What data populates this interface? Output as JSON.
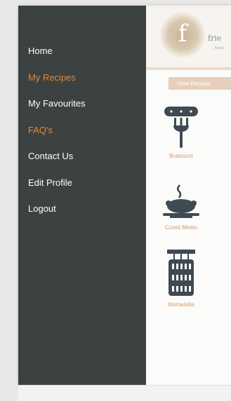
{
  "drawer": {
    "items": [
      {
        "label": "Home",
        "accent": false
      },
      {
        "label": "My Recipes",
        "accent": true
      },
      {
        "label": "My Favourites",
        "accent": false
      },
      {
        "label": "FAQ's",
        "accent": true
      },
      {
        "label": "Contact Us",
        "accent": false
      },
      {
        "label": "Edit Profile",
        "accent": false
      },
      {
        "label": "Logout",
        "accent": false
      }
    ]
  },
  "header": {
    "logo_letter": "f",
    "brand": "frie",
    "brand_sub": "· Rand"
  },
  "main": {
    "view_button": "View Recipes",
    "categories": [
      {
        "label": "Bratwurst",
        "icon": "sausage-fork-icon"
      },
      {
        "label": "Cured Meats",
        "icon": "roast-platter-icon"
      },
      {
        "label": "Mortadella",
        "icon": "mortadella-hanging-icon"
      }
    ]
  },
  "colors": {
    "drawer_bg": "#3c4141",
    "menu_text": "#ffffff",
    "menu_accent": "#e08a35",
    "tile_label": "#d89a6a",
    "icon_color": "#3f4a53"
  }
}
